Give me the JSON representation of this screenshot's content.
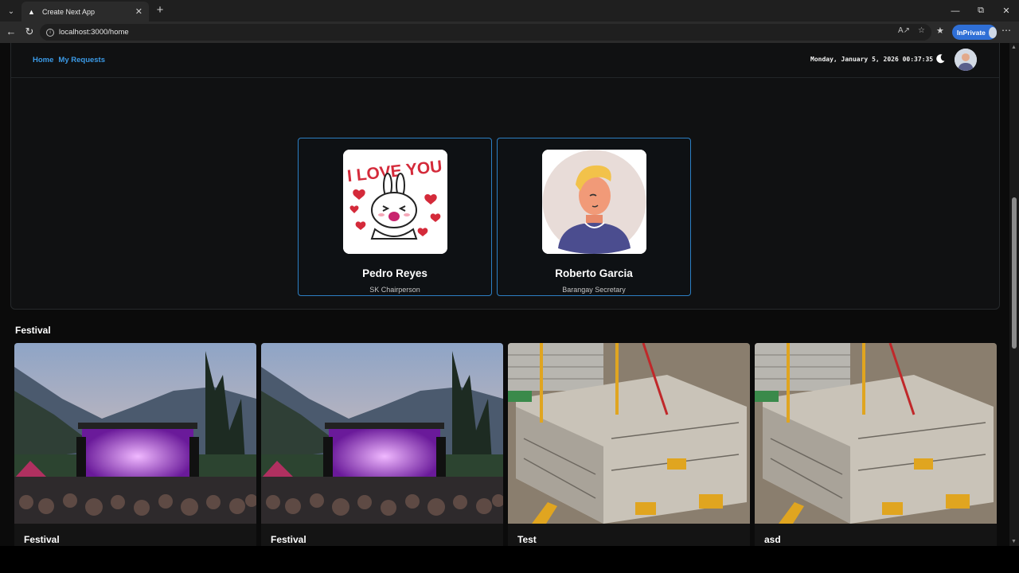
{
  "browser": {
    "tab_title": "Create Next App",
    "url": "localhost:3000/home",
    "inprivate_label": "InPrivate"
  },
  "nav": {
    "links": [
      {
        "label": "Home"
      },
      {
        "label": "My Requests"
      }
    ],
    "datetime": "Monday, January 5, 2026 00:37:35"
  },
  "officials": [
    {
      "name": "Pedro Reyes",
      "role": "SK Chairperson"
    },
    {
      "name": "Roberto Garcia",
      "role": "Barangay Secretary"
    }
  ],
  "section": {
    "title": "Festival"
  },
  "events": [
    {
      "title": "Festival",
      "image": "concert"
    },
    {
      "title": "Festival",
      "image": "concert"
    },
    {
      "title": "Test",
      "image": "construction"
    },
    {
      "title": "asd",
      "image": "construction"
    }
  ],
  "colors": {
    "accent": "#3b9ae6",
    "card_border": "#2c7fc4",
    "background": "#0b0b0b"
  }
}
